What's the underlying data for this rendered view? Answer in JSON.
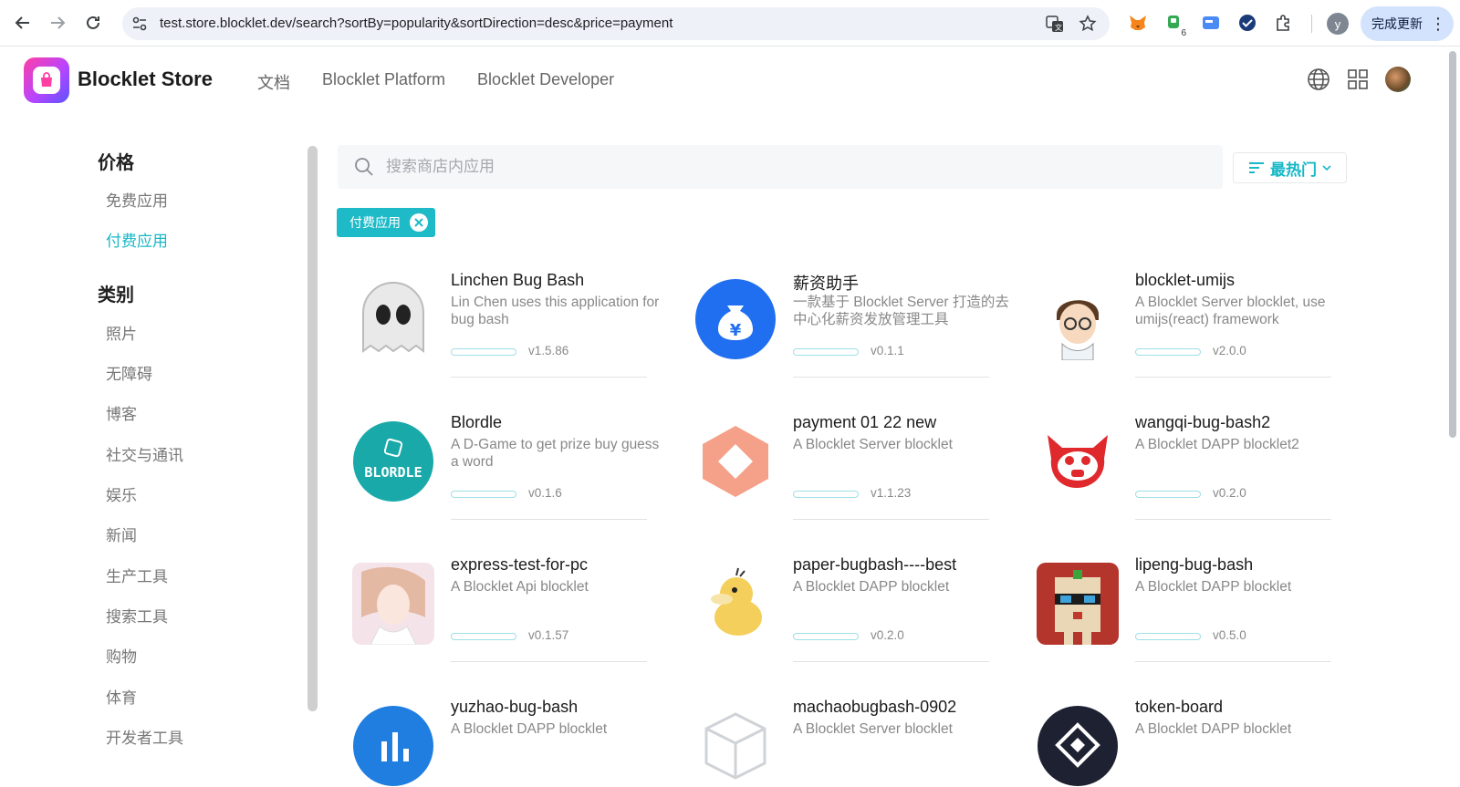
{
  "browser": {
    "url": "test.store.blocklet.dev/search?sortBy=popularity&sortDirection=desc&price=payment",
    "profile_initial": "y",
    "update_label": "完成更新",
    "extension_badge": "6"
  },
  "header": {
    "brand": "Blocklet Store",
    "nav": [
      "文档",
      "Blocklet Platform",
      "Blocklet Developer"
    ]
  },
  "sidebar": {
    "price_title": "价格",
    "price_items": [
      "免费应用",
      "付费应用"
    ],
    "active_price": "付费应用",
    "category_title": "类别",
    "category_items": [
      "照片",
      "无障碍",
      "博客",
      "社交与通讯",
      "娱乐",
      "新闻",
      "生产工具",
      "搜索工具",
      "购物",
      "体育",
      "开发者工具"
    ]
  },
  "search": {
    "placeholder": "搜索商店内应用",
    "sort_label": "最热门"
  },
  "filter_chip": {
    "label": "付费应用"
  },
  "apps": [
    {
      "title": "Linchen Bug Bash",
      "desc": "Lin Chen uses this application for bug bash",
      "version": "v1.5.86",
      "icon": "ghost-icon"
    },
    {
      "title": "薪资助手",
      "desc": "一款基于 Blocklet Server 打造的去中心化薪资发放管理工具",
      "version": "v0.1.1",
      "icon": "money-bag-icon"
    },
    {
      "title": "blocklet-umijs",
      "desc": "A Blocklet Server blocklet, use umijs(react) framework",
      "version": "v2.0.0",
      "icon": "cartoon-boy-icon"
    },
    {
      "title": "Blordle",
      "desc": "A D-Game to get prize buy guess a word",
      "version": "v0.1.6",
      "icon": "blordle-logo-icon"
    },
    {
      "title": "payment 01 22 new",
      "desc": "A Blocklet Server blocklet",
      "version": "v1.1.23",
      "icon": "hexagon-diamond-icon"
    },
    {
      "title": "wangqi-bug-bash2",
      "desc": "A Blocklet DAPP blocklet2",
      "version": "v0.2.0",
      "icon": "devil-face-icon"
    },
    {
      "title": "express-test-for-pc",
      "desc": "A Blocklet Api blocklet",
      "version": "v0.1.57",
      "icon": "anime-girl-icon"
    },
    {
      "title": "paper-bugbash----best",
      "desc": "A Blocklet DAPP blocklet",
      "version": "v0.2.0",
      "icon": "psyduck-icon"
    },
    {
      "title": "lipeng-bug-bash",
      "desc": "A Blocklet DAPP blocklet",
      "version": "v0.5.0",
      "icon": "pixel-character-icon"
    },
    {
      "title": "yuzhao-bug-bash",
      "desc": "A Blocklet DAPP blocklet",
      "version": "",
      "icon": "bar-chart-icon"
    },
    {
      "title": "machaobugbash-0902",
      "desc": "A Blocklet Server blocklet",
      "version": "",
      "icon": "cube-icon"
    },
    {
      "title": "token-board",
      "desc": "A Blocklet DAPP blocklet",
      "version": "",
      "icon": "diamond-token-icon"
    }
  ],
  "colors": {
    "accent": "#1fbac8",
    "text_muted": "#888888"
  }
}
